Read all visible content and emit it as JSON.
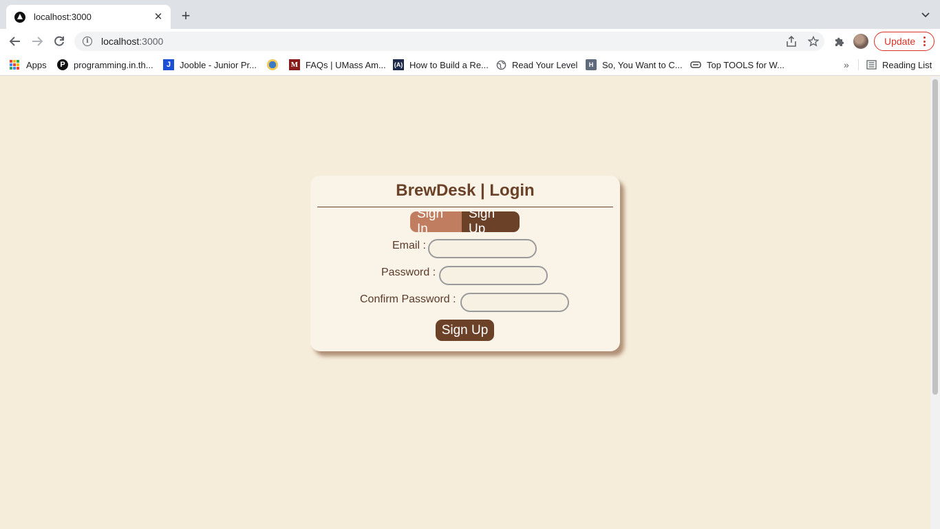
{
  "browser": {
    "tab": {
      "title": "localhost:3000"
    },
    "address_bar": {
      "host": "localhost",
      "port": ":3000"
    },
    "update_button": "Update",
    "bookmarks": [
      {
        "label": "Apps",
        "icon": "apps-grid-icon"
      },
      {
        "label": "programming.in.th...",
        "icon": "p-logo-icon"
      },
      {
        "label": "Jooble - Junior Pr...",
        "icon": "j-logo-icon"
      },
      {
        "label": "",
        "icon": "globe-emblem-icon"
      },
      {
        "label": "FAQs | UMass Am...",
        "icon": "m-logo-icon"
      },
      {
        "label": "How to Build a Re...",
        "icon": "a-logo-icon"
      },
      {
        "label": "Read Your Level",
        "icon": "globe-icon"
      },
      {
        "label": "So, You Want to C...",
        "icon": "h-logo-icon"
      },
      {
        "label": "Top TOOLS for W...",
        "icon": "tools-icon"
      }
    ],
    "reading_list": "Reading List"
  },
  "login": {
    "title": "BrewDesk | Login",
    "tabs": {
      "sign_in": "Sign In",
      "sign_up": "Sign Up"
    },
    "fields": {
      "email": {
        "label": "Email :",
        "value": ""
      },
      "password": {
        "label": "Password :",
        "value": ""
      },
      "confirm_password": {
        "label": "Confirm Password :",
        "value": ""
      }
    },
    "submit": "Sign Up"
  },
  "colors": {
    "page_bg": "#f5ecd9",
    "brand_dark": "#6b4128",
    "brand_light": "#c17d5f",
    "card_bg": "#f9f3e8"
  }
}
